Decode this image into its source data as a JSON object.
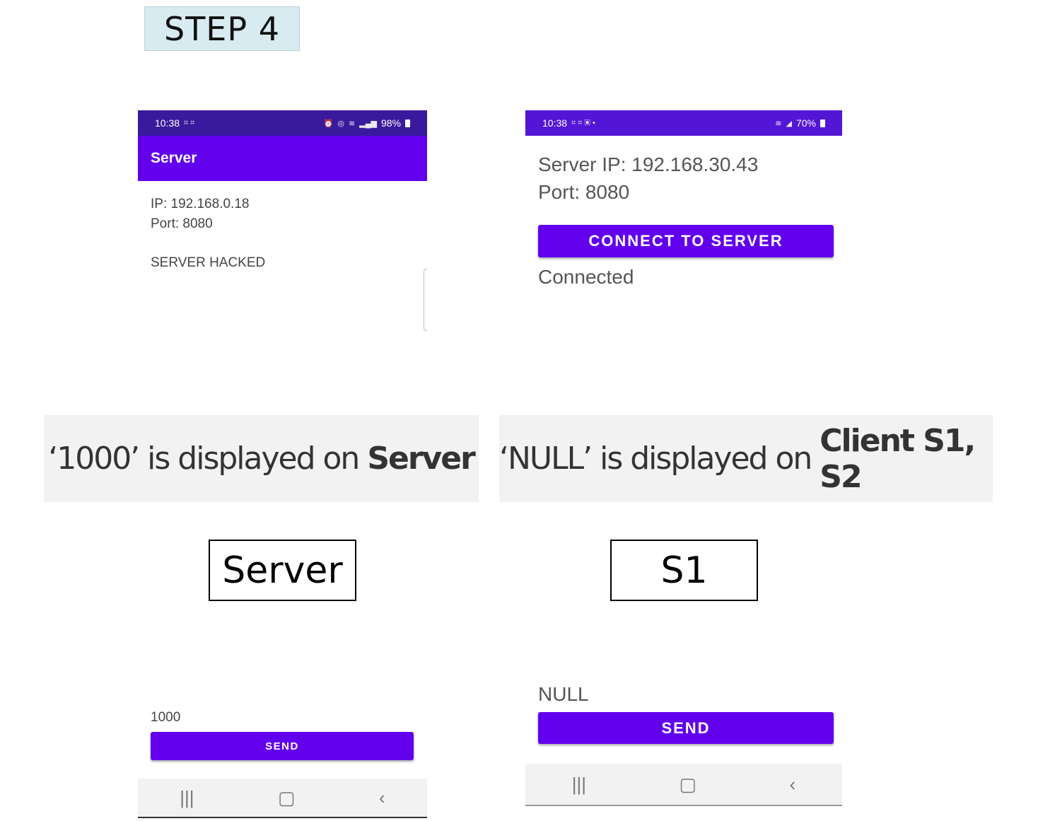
{
  "step_label": "STEP 4",
  "server_screen": {
    "status_time": "10:38",
    "status_battery": "98%",
    "app_title": "Server",
    "ip_text": "IP: 192.168.0.18",
    "port_text": "Port: 8080",
    "message": "SERVER HACKED"
  },
  "client_screen": {
    "status_time": "10:38",
    "status_battery": "70%",
    "server_ip_text": "Server IP: 192.168.30.43",
    "port_text": "Port: 8080",
    "connect_button": "CONNECT TO SERVER",
    "connection_status": "Connected"
  },
  "captions": {
    "left_prefix": "‘1000’ is displayed on ",
    "left_bold": "Server",
    "right_prefix": "‘NULL’ is displayed on ",
    "right_bold": "Client S1, S2"
  },
  "labels": {
    "server": "Server",
    "client": "S1"
  },
  "server_bottom": {
    "value": "1000",
    "send_button": "SEND"
  },
  "client_bottom": {
    "value": "NULL",
    "send_button": "SEND"
  },
  "nav_icons": [
    "recent-apps-icon",
    "home-icon",
    "back-icon"
  ],
  "colors": {
    "status_bar": "#3a1a9c",
    "primary": "#6200ee",
    "caption_bg": "#f2f2f2",
    "step_bg": "#d7ebf0"
  }
}
